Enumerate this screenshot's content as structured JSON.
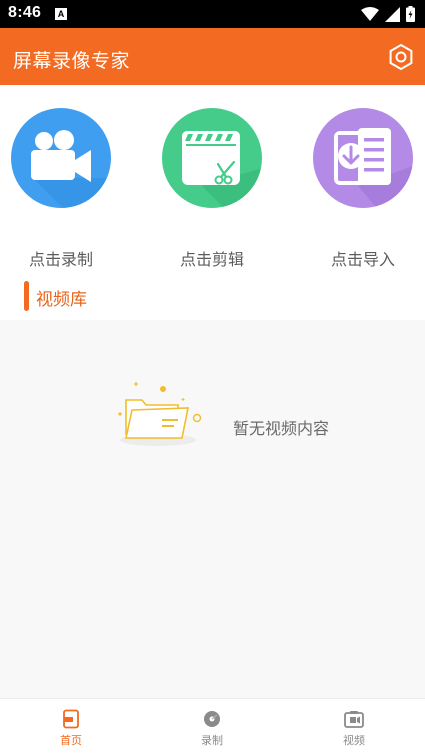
{
  "status_bar": {
    "time": "8:46",
    "notification_letter": "A"
  },
  "app_bar": {
    "title": "屏幕录像专家",
    "settings_icon": "settings-hexagon-icon"
  },
  "actions": [
    {
      "label": "点击录制",
      "icon": "video-camera-icon",
      "color": "#3f9ef0"
    },
    {
      "label": "点击剪辑",
      "icon": "clapper-scissors-icon",
      "color": "#45cb8a"
    },
    {
      "label": "点击导入",
      "icon": "import-document-icon",
      "color": "#b38ae6"
    }
  ],
  "library": {
    "title": "视频库",
    "empty_text": "暂无视频内容",
    "empty_icon": "empty-folder-icon"
  },
  "bottom_nav": [
    {
      "label": "首页",
      "icon": "home-icon",
      "active": true
    },
    {
      "label": "录制",
      "icon": "record-icon",
      "active": false
    },
    {
      "label": "视频",
      "icon": "video-folder-icon",
      "active": false
    }
  ],
  "colors": {
    "accent": "#f36a22",
    "inactive": "#8a8a8a",
    "background": "#f8f8f8"
  }
}
